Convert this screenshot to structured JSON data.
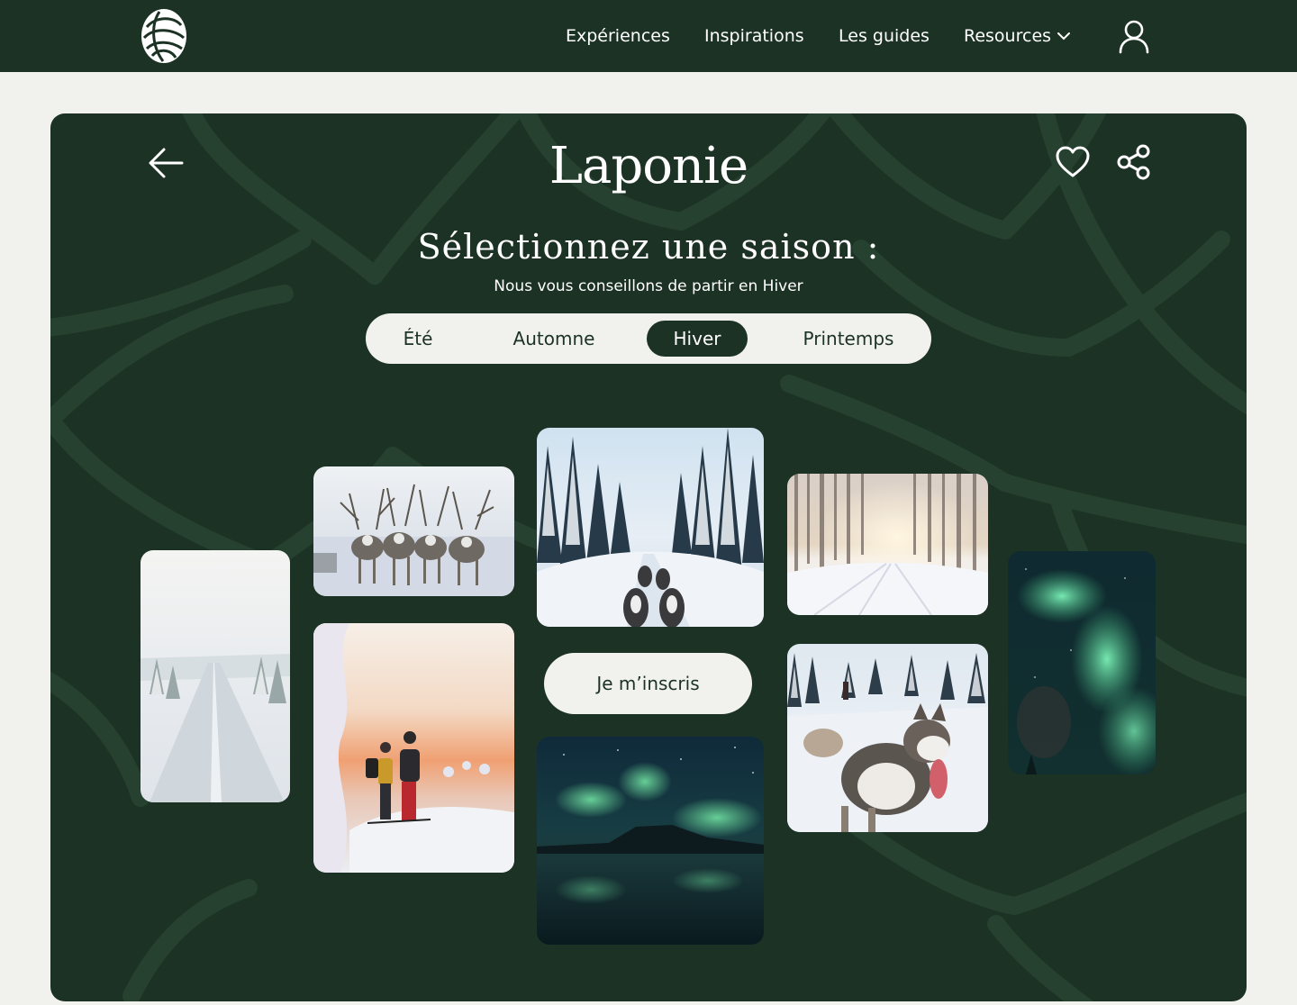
{
  "nav": {
    "logo_icon": "swirl-logo-icon",
    "items": [
      {
        "label": "Expériences"
      },
      {
        "label": "Inspirations"
      },
      {
        "label": "Les guides"
      },
      {
        "label": "Resources",
        "icon": "chevron-down-icon"
      }
    ],
    "user_icon": "user-icon"
  },
  "card": {
    "title": "Laponie",
    "subtitle": "Sélectionnez une saison :",
    "advice": "Nous vous conseillons de partir en Hiver",
    "icons": [
      "back-arrow-icon",
      "heart-icon",
      "share-icon"
    ],
    "seasons": [
      {
        "label": "Été",
        "active": false
      },
      {
        "label": "Automne",
        "active": false
      },
      {
        "label": "Hiver",
        "active": true
      },
      {
        "label": "Printemps",
        "active": false
      }
    ],
    "cta_label": "Je m’inscris"
  },
  "photos": [
    "snowy-road-photo",
    "reindeer-photo",
    "skiers-sunset-photo",
    "husky-sled-forest-photo",
    "aurora-lake-photo",
    "sunlit-forest-photo",
    "husky-dogs-photo",
    "aurora-closeup-photo"
  ],
  "colors": {
    "forest_green": "#1c3224",
    "pattern_line": "#26412f",
    "cream": "#f1f2ee",
    "white": "#ffffff"
  }
}
